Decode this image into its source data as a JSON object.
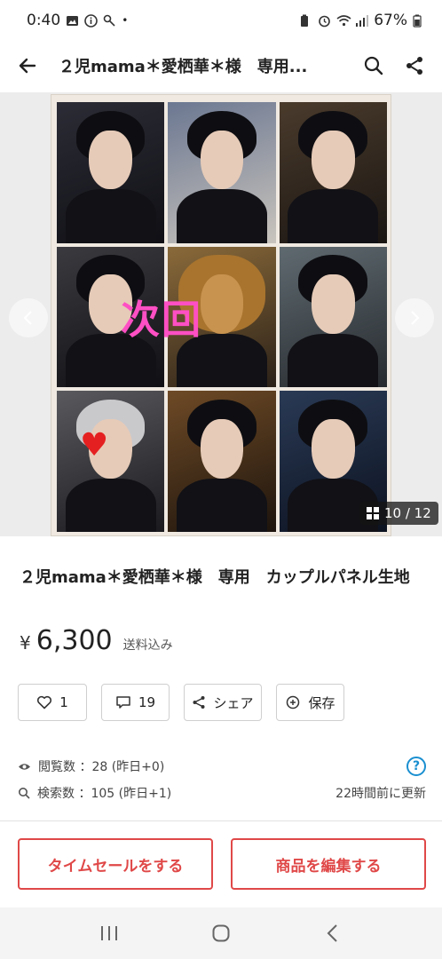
{
  "status_bar": {
    "time": "0:40",
    "battery": "67%"
  },
  "app_bar": {
    "title": "２児mama＊愛栖華＊様　専用..."
  },
  "gallery": {
    "overlay_text": "次回",
    "heart": "♥",
    "counter": "10 / 12"
  },
  "product": {
    "title": "２児mama＊愛栖華＊様　専用　カップルパネル生地",
    "currency": "¥",
    "price": "6,300",
    "shipping": "送料込み"
  },
  "actions": {
    "like_count": "1",
    "comment_count": "19",
    "share_label": "シェア",
    "save_label": "保存"
  },
  "stats": {
    "views": "閲覧数 ：28 (昨日+0)",
    "searches": "検索数 ：105 (昨日+1)",
    "updated": "22時間前に更新",
    "help": "?"
  },
  "buttons": {
    "time_sale": "タイムセールをする",
    "edit_item": "商品を編集する"
  },
  "colors": {
    "accent_red": "#e04848",
    "overlay_pink": "#ff4fc4",
    "help_blue": "#1a8fd0"
  }
}
